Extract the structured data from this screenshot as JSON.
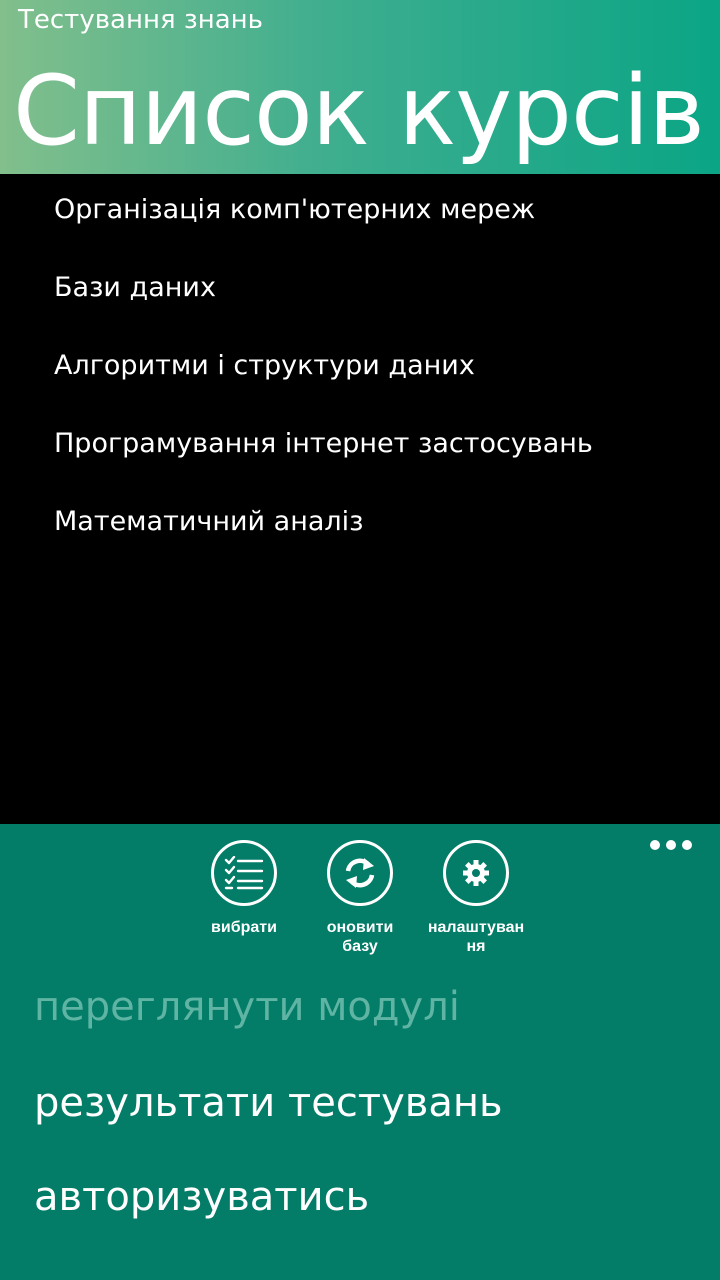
{
  "header": {
    "app_title": "Тестування знань",
    "page_title": "Список курсів"
  },
  "courses": [
    {
      "label": "Організація комп'ютерних мереж"
    },
    {
      "label": "Бази даних"
    },
    {
      "label": "Алгоритми і структури даних"
    },
    {
      "label": "Програмування інтернет застосувань"
    },
    {
      "label": "Математичний аналіз"
    }
  ],
  "app_bar": {
    "buttons": [
      {
        "label": "вибрати",
        "icon": "list-check-icon"
      },
      {
        "label": "оновити базу",
        "icon": "refresh-icon"
      },
      {
        "label": "налаштування",
        "icon": "gear-icon"
      }
    ],
    "more_icon": "ellipsis-icon",
    "menu_items": [
      {
        "label": "переглянути модулі",
        "enabled": false
      },
      {
        "label": "результати тестувань",
        "enabled": true
      },
      {
        "label": "авторизуватись",
        "enabled": true
      }
    ]
  },
  "colors": {
    "header_gradient_start": "#82bf8c",
    "header_gradient_end": "#0aa585",
    "app_bar": "#037c68",
    "disabled_text": "#5fb4a4",
    "background": "#000000",
    "text": "#ffffff"
  }
}
